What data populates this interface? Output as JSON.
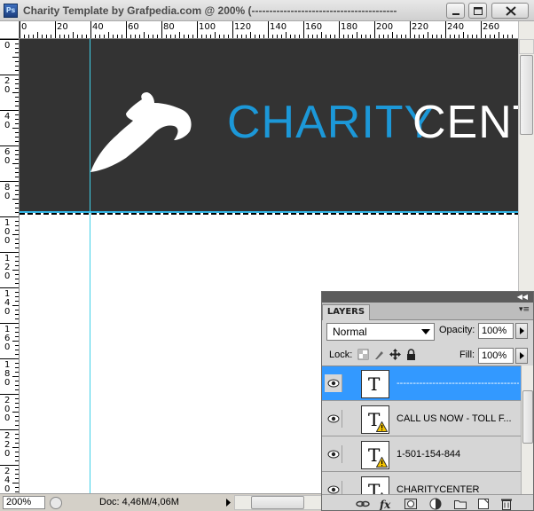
{
  "window": {
    "title": "Charity Template by Grafpedia.com @ 200% (-----------------------------------------",
    "app_icon": "ps-icon",
    "controls": [
      "minimize-icon",
      "maximize-icon",
      "close-icon"
    ]
  },
  "rulers": {
    "horizontal": [
      "0",
      "20",
      "40",
      "60",
      "80",
      "100",
      "120",
      "140",
      "160",
      "180",
      "200",
      "220",
      "240",
      "260"
    ],
    "vertical": [
      "0",
      "20",
      "40",
      "60",
      "80",
      "100",
      "120",
      "140",
      "160",
      "180",
      "200",
      "220",
      "240"
    ]
  },
  "canvas": {
    "brand_part1": "CHARITY",
    "brand_part2": "CENT",
    "brand_color": "#1c98d8",
    "header_bg": "#333333",
    "accent_line": "#33b5e5"
  },
  "status": {
    "zoom": "200%",
    "doc": "Doc: 4,46M/4,06M"
  },
  "layers_panel": {
    "tab": "LAYERS",
    "blend_mode": "Normal",
    "opacity_label": "Opacity:",
    "opacity": "100%",
    "lock_label": "Lock:",
    "fill_label": "Fill:",
    "fill": "100%",
    "layers": [
      {
        "name": "-----------------------------------------",
        "selected": true,
        "warning": false
      },
      {
        "name": "CALL US NOW - TOLL F...",
        "selected": false,
        "warning": true
      },
      {
        "name": "1-501-154-844",
        "selected": false,
        "warning": true
      },
      {
        "name": "CHARITYCENTER",
        "selected": false,
        "warning": true
      }
    ]
  }
}
